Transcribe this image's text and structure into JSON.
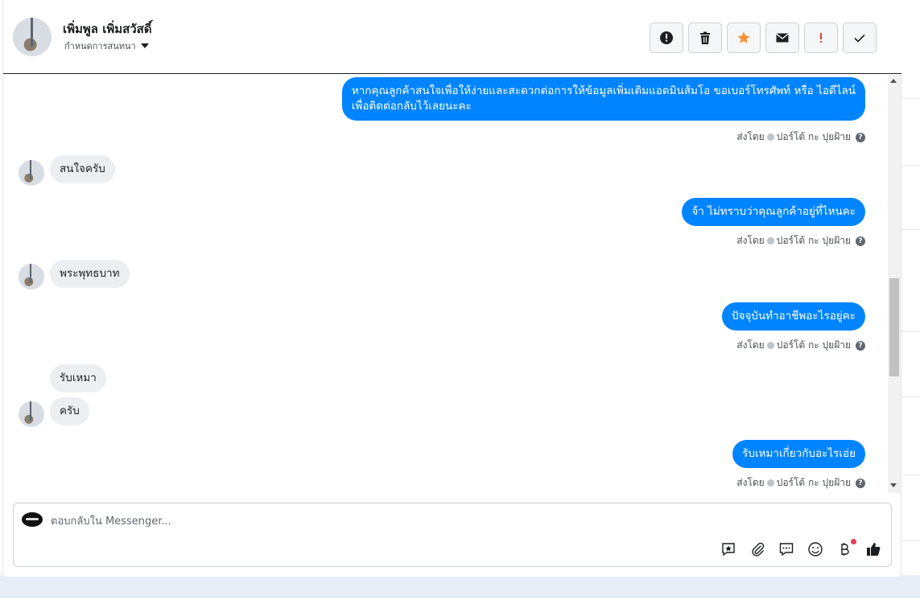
{
  "header": {
    "contact_name": "เพิ่มพูล เพิ่มสวัสดิ์",
    "assign_label": "กำหนดการสนทนา"
  },
  "toolbar": {
    "icons": [
      "alert-circle-icon",
      "trash-icon",
      "star-icon",
      "envelope-icon",
      "exclamation-icon",
      "check-icon"
    ],
    "star_color": "#f7923a",
    "exclamation_color": "#e53935"
  },
  "messages": [
    {
      "direction": "out",
      "lines": [
        "หากคุณลูกค้าสนใจเพื่อให้ง่ายและสะดวกต่อการให้ข้อมูลเพิ่มเติมแอดมินส้มโอ ขอเบอร์โทรศัพท์ หรือ ไอดีไลน์",
        "เพื่อติดต่อกลับไว้เลยนะคะ"
      ],
      "sent_by": "ส่งโดย",
      "agent": "ปอร์โต้ กะ ปุยฝ้าย"
    },
    {
      "direction": "in",
      "text": "สนใจครับ"
    },
    {
      "direction": "out",
      "text": "จ้า ไม่ทราบว่าคุณลูกค้าอยู่ที่ไหนคะ",
      "sent_by": "ส่งโดย",
      "agent": "ปอร์โต้ กะ ปุยฝ้าย"
    },
    {
      "direction": "in",
      "text": "พระพุทธบาท"
    },
    {
      "direction": "out",
      "text": "ปัจจุบันทำอาชีพอะไรอยู่คะ",
      "sent_by": "ส่งโดย",
      "agent": "ปอร์โต้ กะ ปุยฝ้าย"
    },
    {
      "direction": "in",
      "text": "รับเหมา"
    },
    {
      "direction": "in",
      "text": "ครับ"
    },
    {
      "direction": "out",
      "text": "รับเหมาเกี่ยวกับอะไรเอ่ย",
      "sent_by": "ส่งโดย",
      "agent": "ปอร์โต้ กะ ปุยฝ้าย"
    }
  ],
  "composer": {
    "placeholder": "ตอบกลับใน Messenger...",
    "icons": [
      "saved-reply-icon",
      "attachment-icon",
      "chat-bubble-icon",
      "emoji-icon",
      "baht-payment-icon",
      "thumbs-up-icon"
    ]
  },
  "colors": {
    "outgoing_bubble": "#0084ff",
    "incoming_bubble": "#eceff2",
    "notification_dot": "#e4405f"
  }
}
